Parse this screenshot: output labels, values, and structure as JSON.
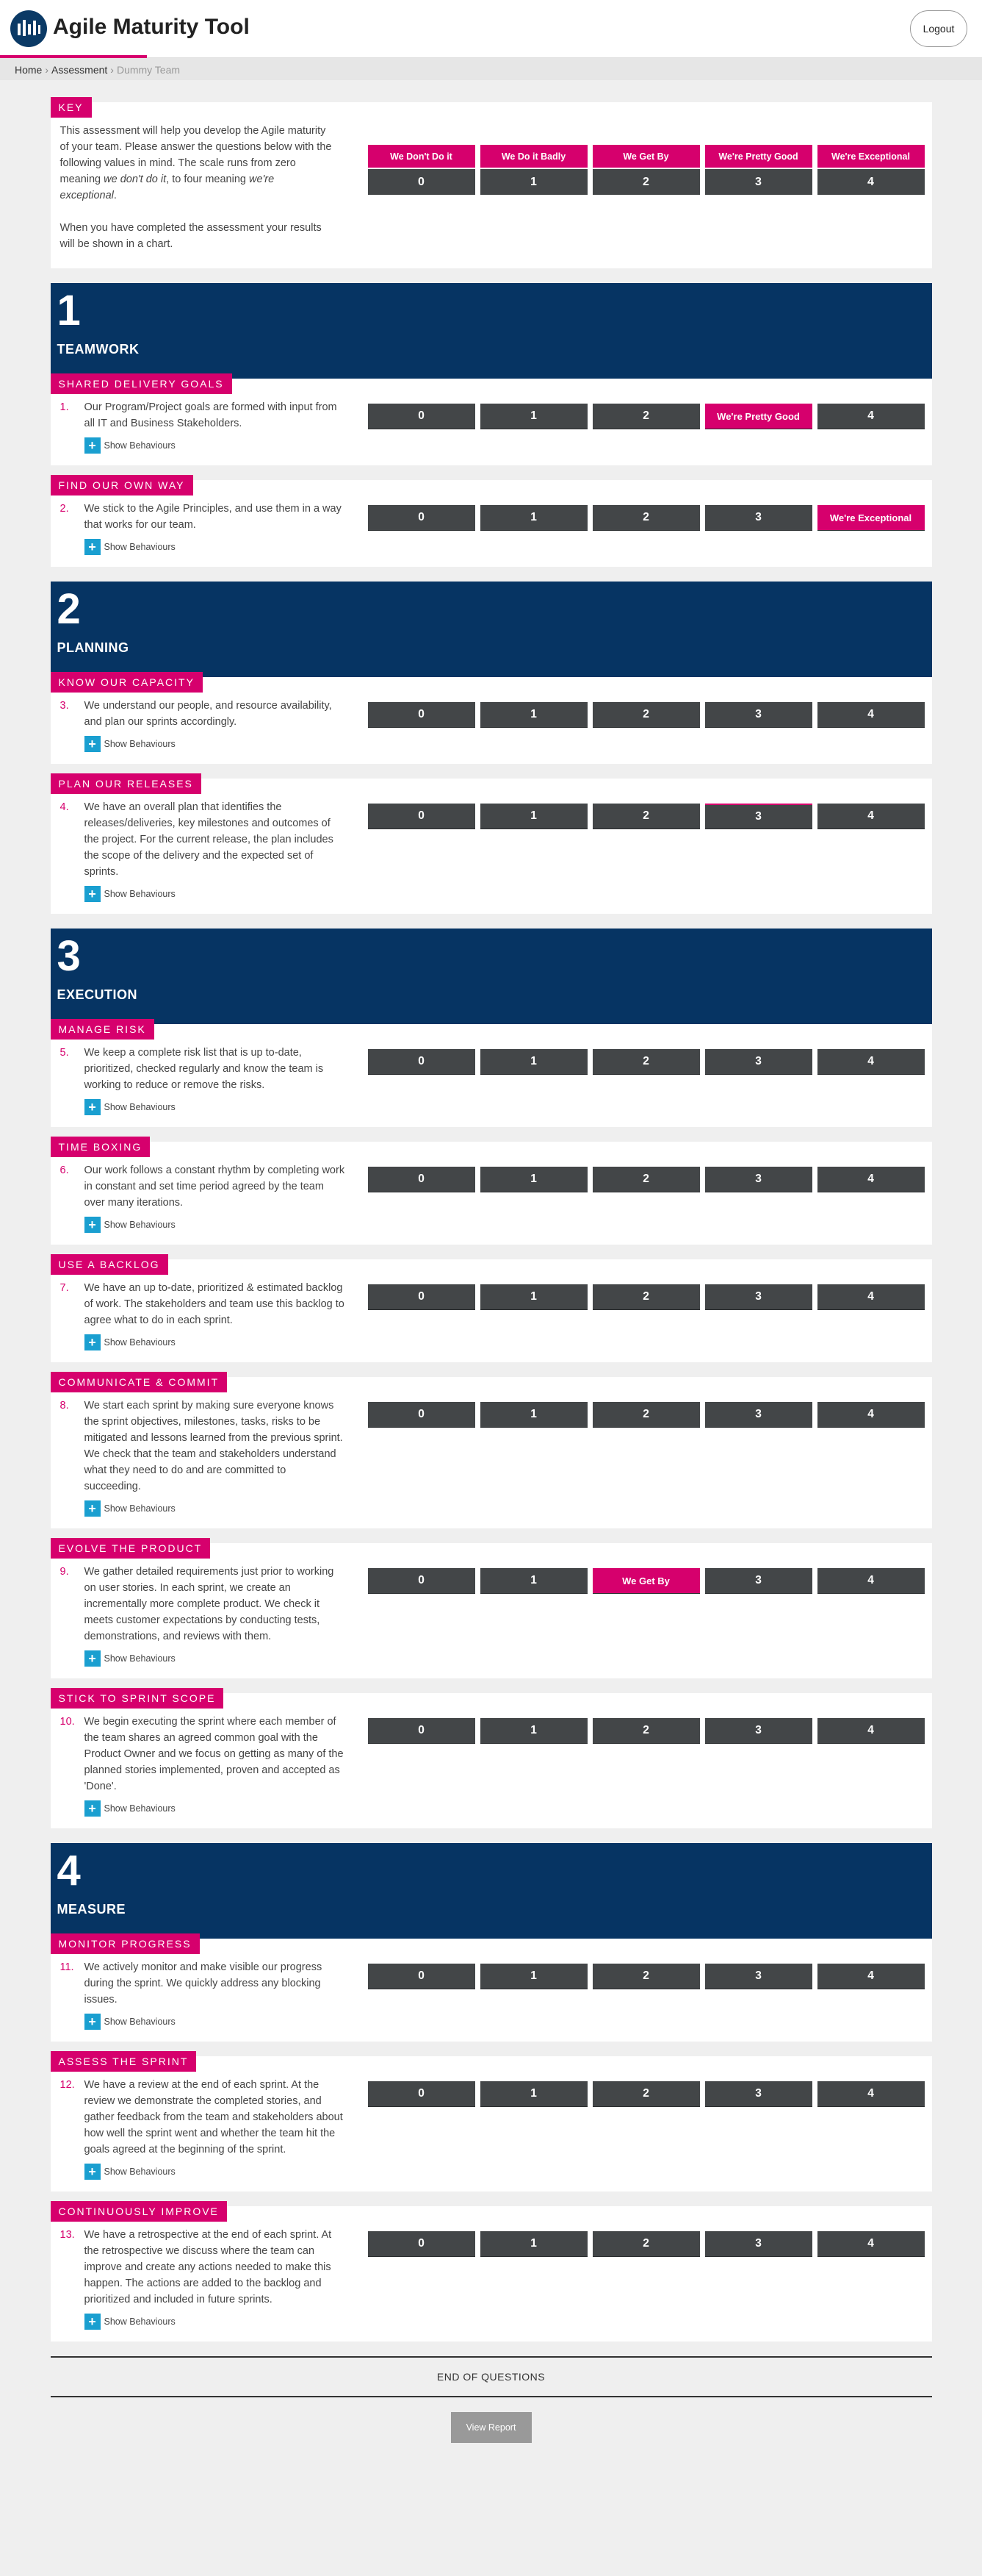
{
  "header": {
    "title": "Agile Maturity Tool",
    "logout_label": "Logout"
  },
  "breadcrumb": {
    "home": "Home",
    "assessment": "Assessment",
    "current": "Dummy Team"
  },
  "key": {
    "tag": "KEY",
    "para1_a": "This assessment will help you develop the Agile maturity of your team. Please answer the questions below with the following values in mind. The scale runs from zero meaning ",
    "para1_em1": "we don't do it",
    "para1_b": ", to four meaning ",
    "para1_em2": "we're exceptional",
    "para1_c": ".",
    "para2": "When you have completed the assessment your results will be shown in a chart.",
    "labels": [
      "We Don't Do it",
      "We Do it Badly",
      "We Get By",
      "We're Pretty Good",
      "We're Exceptional"
    ],
    "scores": [
      "0",
      "1",
      "2",
      "3",
      "4"
    ]
  },
  "show_behaviours": "Show Behaviours",
  "score_values": [
    "0",
    "1",
    "2",
    "3",
    "4"
  ],
  "selected_labels": {
    "2": "We Get By",
    "3": "We're Pretty Good",
    "4": "We're Exceptional"
  },
  "sections": [
    {
      "number": "1",
      "name": "TEAMWORK",
      "questions": [
        {
          "tag": "SHARED DELIVERY GOALS",
          "num": "1.",
          "text": "Our Program/Project goals are formed with input from all IT and Business Stakeholders.",
          "selected": 3
        },
        {
          "tag": "FIND OUR OWN WAY",
          "num": "2.",
          "text": "We stick to the Agile Principles, and use them in a way that works for our team.",
          "selected": 4
        }
      ]
    },
    {
      "number": "2",
      "name": "PLANNING",
      "questions": [
        {
          "tag": "KNOW OUR CAPACITY",
          "num": "3.",
          "text": "We understand our people, and resource availability, and plan our sprints accordingly.",
          "selected": null
        },
        {
          "tag": "PLAN OUR RELEASES",
          "num": "4.",
          "text": "We have an overall plan that identifies the releases/deliveries, key milestones and outcomes of the project. For the current release, the plan includes the scope of the delivery and the expected set of sprints.",
          "selected": null
        }
      ]
    },
    {
      "number": "3",
      "name": "EXECUTION",
      "questions": [
        {
          "tag": "MANAGE RISK",
          "num": "5.",
          "text": "We keep a complete risk list that is up to-date, prioritized, checked regularly and know the team is working to reduce or remove the risks.",
          "selected": null
        },
        {
          "tag": "TIME BOXING",
          "num": "6.",
          "text": "Our work follows a constant rhythm by completing work in constant and set time period agreed by the team over many iterations.",
          "selected": null
        },
        {
          "tag": "USE A BACKLOG",
          "num": "7.",
          "text": "We have an up to-date, prioritized & estimated backlog of work. The stakeholders and team use this backlog to agree what to do in each sprint.",
          "selected": null
        },
        {
          "tag": "COMMUNICATE & COMMIT",
          "num": "8.",
          "text": "We start each sprint by making sure everyone knows the sprint objectives, milestones, tasks, risks to be mitigated and lessons learned from the previous sprint. We check that the team and stakeholders understand what they need to do and are committed to succeeding.",
          "selected": null
        },
        {
          "tag": "EVOLVE THE PRODUCT",
          "num": "9.",
          "text": "We gather detailed requirements just prior to working on user stories. In each sprint, we create an incrementally more complete product. We check it meets customer expectations by conducting tests, demonstrations, and reviews with them.",
          "selected": 2
        },
        {
          "tag": "STICK TO SPRINT SCOPE",
          "num": "10.",
          "text": "We begin executing the sprint where each member of the team shares an agreed common goal with the Product Owner and we focus on getting as many of the planned stories implemented, proven and accepted as 'Done'.",
          "selected": null
        }
      ]
    },
    {
      "number": "4",
      "name": "MEASURE",
      "questions": [
        {
          "tag": "MONITOR PROGRESS",
          "num": "11.",
          "text": "We actively monitor and make visible our progress during the sprint. We quickly address any blocking issues.",
          "selected": null
        },
        {
          "tag": "ASSESS THE SPRINT",
          "num": "12.",
          "text": "We have a review at the end of each sprint. At the review we demonstrate the completed stories, and gather feedback from the team and stakeholders about how well the sprint went and whether the team hit the goals agreed at the beginning of the sprint.",
          "selected": null
        },
        {
          "tag": "CONTINUOUSLY IMPROVE",
          "num": "13.",
          "text": "We have a retrospective at the end of each sprint. At the retrospective we discuss where the team can improve and create any actions needed to make this happen. The actions are added to the backlog and prioritized and included in future sprints.",
          "selected": null
        }
      ]
    }
  ],
  "end": {
    "label": "END OF QUESTIONS",
    "view_report": "View Report"
  }
}
